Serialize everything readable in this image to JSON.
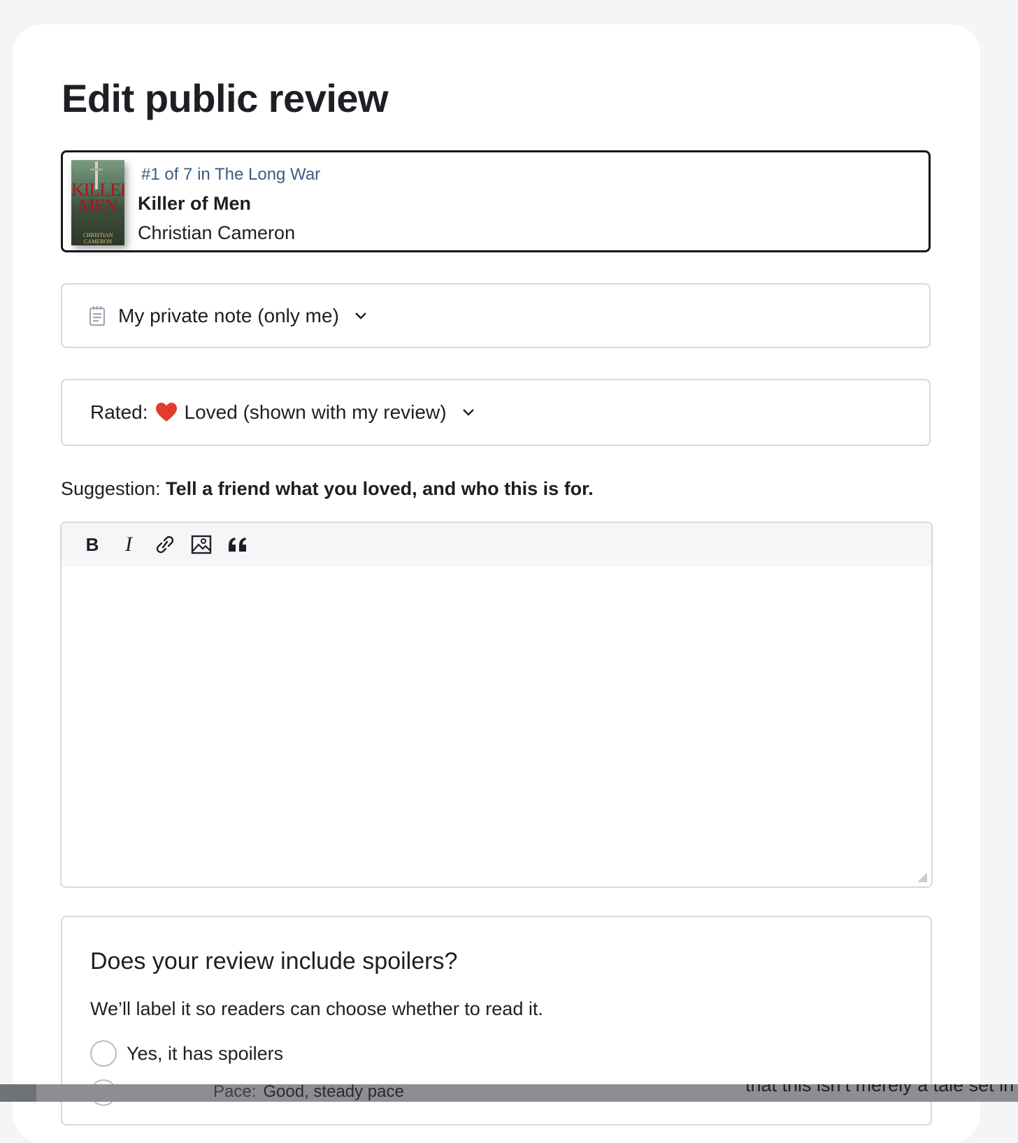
{
  "page": {
    "title": "Edit public review"
  },
  "book": {
    "series": "#1 of 7 in The Long War",
    "title": "Killer of Men",
    "author": "Christian Cameron",
    "cover_line1": "KILLER",
    "cover_line2": "MEN",
    "cover_author": "CHRISTIAN CAMERON"
  },
  "private_note": {
    "label": "My private note (only me)",
    "icon": "note-icon"
  },
  "rating": {
    "prefix": "Rated:",
    "value": "Loved (shown with my review)",
    "icon": "heart-icon",
    "heart_color": "#e53b2e"
  },
  "suggestion": {
    "prefix": "Suggestion:",
    "text": "Tell a friend what you loved, and who this is for."
  },
  "editor": {
    "toolbar": [
      "bold",
      "italic",
      "link",
      "image",
      "quote"
    ],
    "bold_label": "B",
    "italic_label": "I",
    "content": ""
  },
  "spoilers": {
    "question": "Does your review include spoilers?",
    "description": "We’ll label it so readers can choose whether to read it.",
    "option_yes": "Yes, it has spoilers"
  },
  "background_peek": {
    "pace_label": "Pace:",
    "pace_value": "Good, steady pace",
    "cut_text": "that this isn’t merely a tale set in"
  }
}
